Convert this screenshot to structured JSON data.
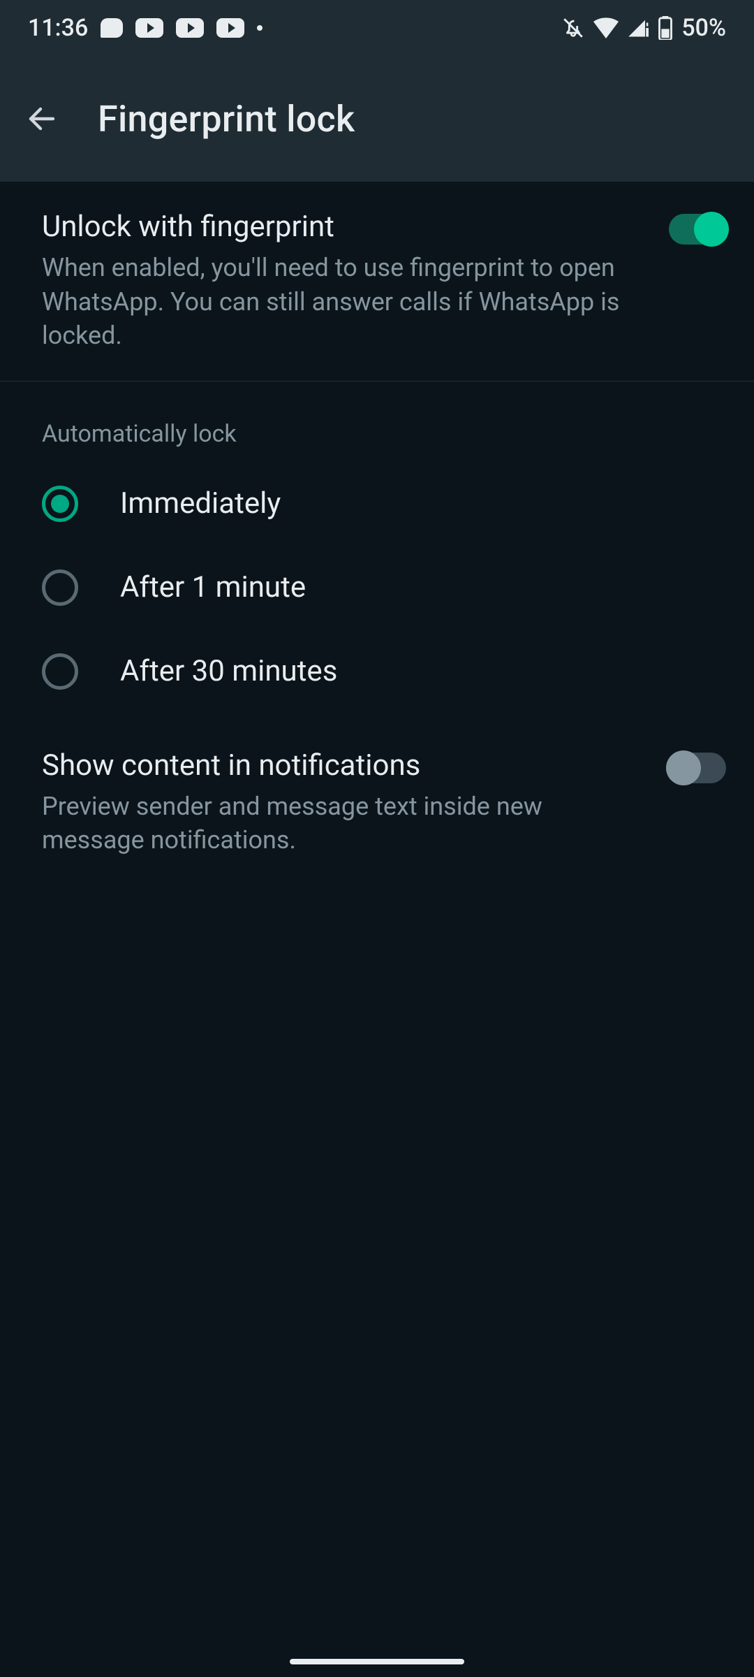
{
  "status": {
    "time": "11:36",
    "battery_text": "50%"
  },
  "header": {
    "title": "Fingerprint lock"
  },
  "unlock": {
    "title": "Unlock with fingerprint",
    "subtitle": "When enabled, you'll need to use fingerprint to open WhatsApp. You can still answer calls if WhatsApp is locked.",
    "enabled": true
  },
  "auto_lock": {
    "header": "Automatically lock",
    "options": [
      {
        "label": "Immediately",
        "selected": true
      },
      {
        "label": "After 1 minute",
        "selected": false
      },
      {
        "label": "After 30 minutes",
        "selected": false
      }
    ]
  },
  "show_content": {
    "title": "Show content in notifications",
    "subtitle": "Preview sender and message text inside new message notifications.",
    "enabled": false
  }
}
